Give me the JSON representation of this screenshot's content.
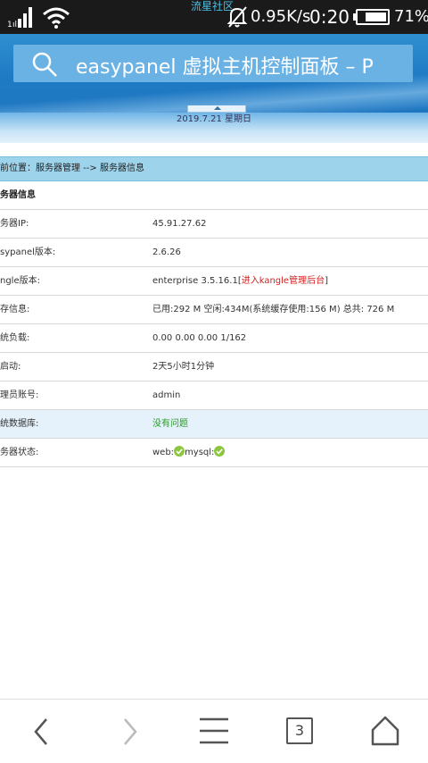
{
  "status_bar": {
    "center_label": "流星社区",
    "net_speed": "0.95K/s",
    "time": "0:20",
    "battery_percent": "71%"
  },
  "browser": {
    "url_text": "easypanel 虚拟主机控制面板 – P"
  },
  "header": {
    "date": "2019.7.21 星期日"
  },
  "breadcrumb": "前位置：服务器管理 --> 服务器信息",
  "table": {
    "title": "务器信息",
    "rows": [
      {
        "label": "务器IP:",
        "value": "45.91.27.62"
      },
      {
        "label": "sypanel版本:",
        "value": "2.6.26"
      },
      {
        "label": "ngle版本:",
        "value": "enterprise 3.5.16.1",
        "link_prefix": "[",
        "link": "进入kangle管理后台",
        "link_suffix": "]"
      },
      {
        "label": "存信息:",
        "value": "已用:292 M 空闲:434M(系统缓存使用:156 M) 总共: 726 M"
      },
      {
        "label": "统负载:",
        "value": "0.00 0.00 0.00 1/162"
      },
      {
        "label": "启动:",
        "value": "2天5小时1分钟"
      },
      {
        "label": "理员账号:",
        "value": "admin"
      },
      {
        "label": "统数据库:",
        "value": "没有问题"
      },
      {
        "label": "务器状态:",
        "web_label": "web:",
        "mysql_label": "mysql:"
      }
    ]
  },
  "bottom_nav": {
    "tab_count": "3"
  },
  "colors": {
    "header_blue": "#1f7ac4",
    "breadcrumb_bg": "#9dd4ec",
    "link_red": "#d42020",
    "ok_green": "#2a9a2a",
    "status_check": "#8cc63f"
  }
}
